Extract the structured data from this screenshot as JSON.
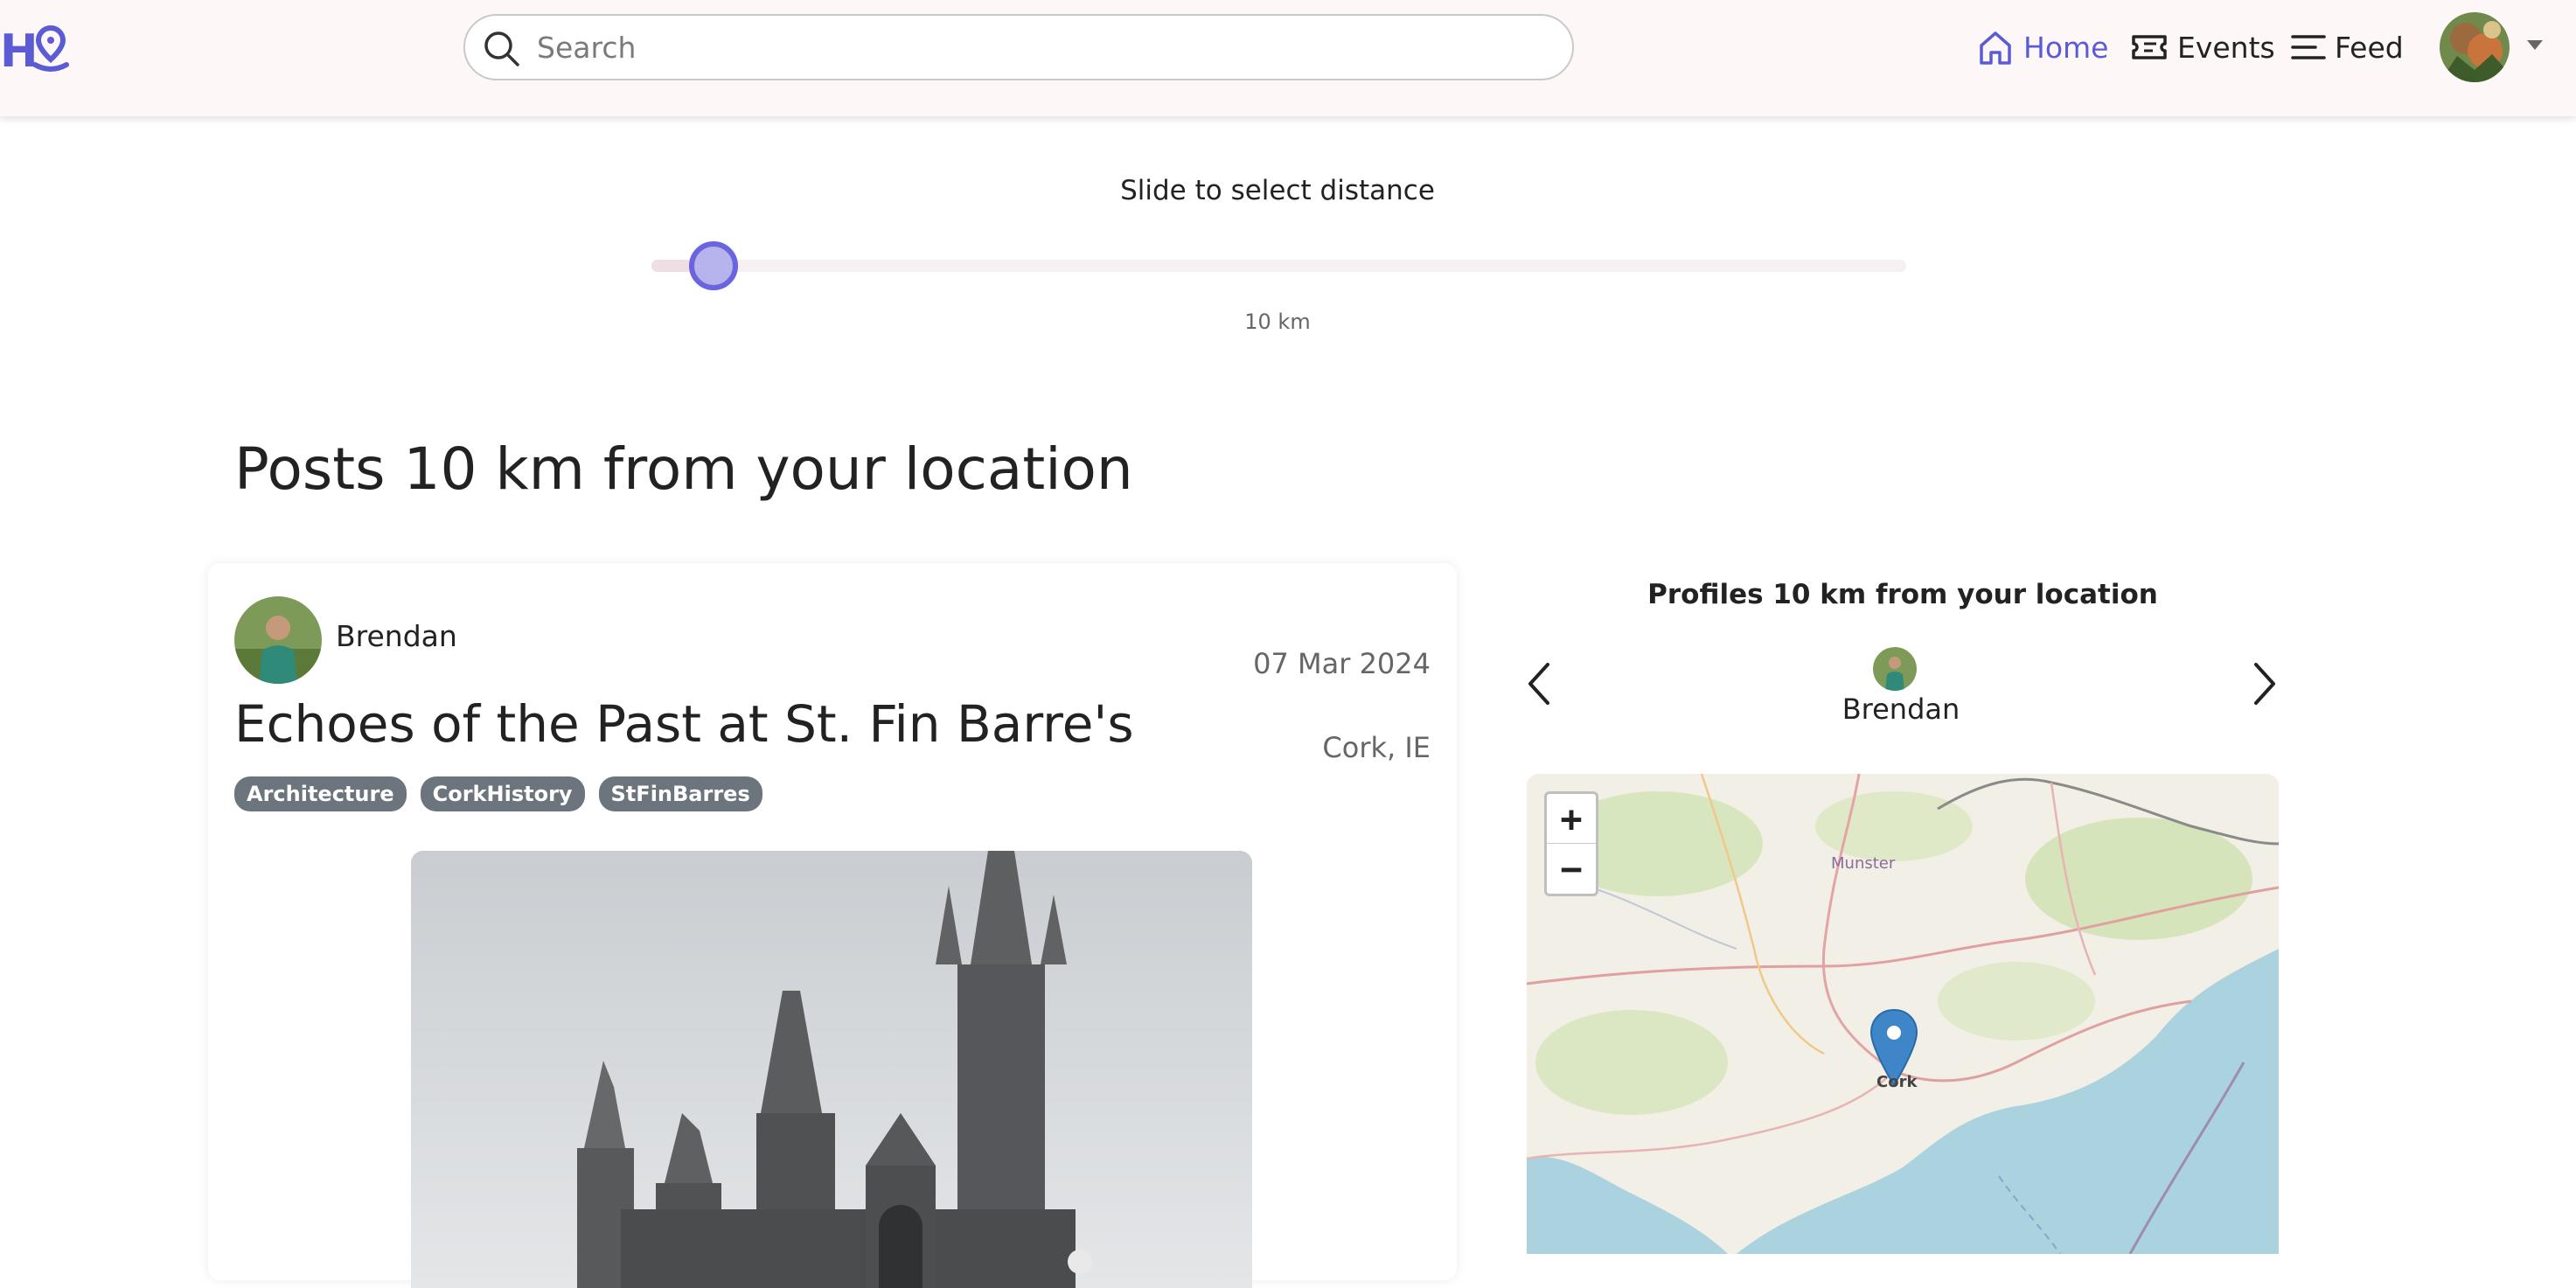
{
  "navbar": {
    "logo_text": "H",
    "search_placeholder": "Search",
    "nav": [
      {
        "label": "Home",
        "active": true
      },
      {
        "label": "Events",
        "active": false
      },
      {
        "label": "Feed",
        "active": false
      }
    ]
  },
  "distance_slider": {
    "title": "Slide to select distance",
    "value_label": "10 km",
    "value_fraction": 0.05
  },
  "posts": {
    "heading": "Posts 10 km from your location",
    "items": [
      {
        "author": "Brendan",
        "date": "07 Mar 2024",
        "title": "Echoes of the Past at St. Fin Barre's",
        "location": "Cork, IE",
        "tags": [
          "Architecture",
          "CorkHistory",
          "StFinBarres"
        ]
      }
    ]
  },
  "profiles": {
    "title": "Profiles 10 km from your location",
    "items": [
      {
        "name": "Brendan"
      }
    ]
  },
  "map": {
    "zoom_in": "+",
    "zoom_out": "−",
    "region_label": "Munster",
    "marker_label": "Cork"
  },
  "colors": {
    "accent": "#5b5bd6",
    "tag_bg": "#6c757d",
    "marker": "#3f86c9",
    "sea": "#aad3df"
  }
}
